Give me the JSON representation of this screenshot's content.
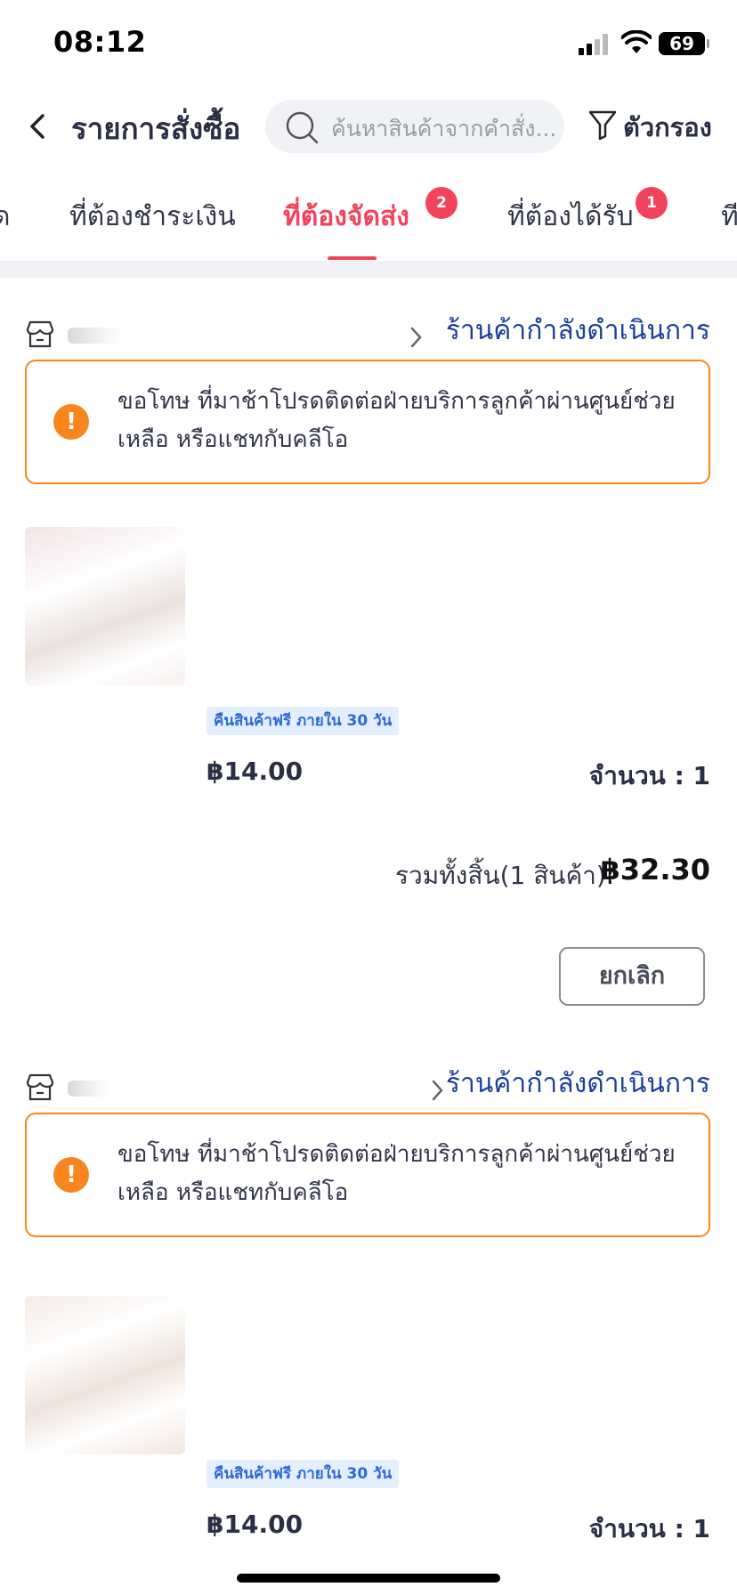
{
  "status_bar": {
    "time": "08:12",
    "battery": "69"
  },
  "header": {
    "title": "รายการสั่งซื้อ",
    "search_placeholder": "ค้นหาสินค้าจากคำสั่ง...",
    "filter_label": "ตัวกรอง"
  },
  "tabs": [
    {
      "label": "ด"
    },
    {
      "label": "ที่ต้องชำระเงิน"
    },
    {
      "label": "ที่ต้องจัดส่ง",
      "badge": "2",
      "active": true
    },
    {
      "label": "ที่ต้องได้รับ",
      "badge": "1"
    },
    {
      "label": "ที"
    }
  ],
  "orders": [
    {
      "shop_status": "ร้านค้ากำลังดำเนินการ",
      "notice": "ขอโทษ ที่มาช้าโปรดติดต่อฝ่ายบริการลูกค้าผ่านศูนย์ช่วยเหลือ หรือแชทกับคลีโอ",
      "tag": "คืนสินค้าฟรี ภายใน 30 วัน",
      "price": "฿14.00",
      "quantity": "จำนวน : 1",
      "total_label": "รวมทั้งสิ้น(1 สินค้า):",
      "total_value": "฿32.30",
      "cancel_label": "ยกเลิก"
    },
    {
      "shop_status": "ร้านค้ากำลังดำเนินการ",
      "notice": "ขอโทษ ที่มาช้าโปรดติดต่อฝ่ายบริการลูกค้าผ่านศูนย์ช่วยเหลือ หรือแชทกับคลีโอ",
      "tag": "คืนสินค้าฟรี ภายใน 30 วัน",
      "price": "฿14.00",
      "quantity": "จำนวน : 1"
    }
  ],
  "colors": {
    "accent": "#f2435b",
    "status_link": "#1b3f9c",
    "notice_border": "#f7861f",
    "tag_bg": "#e3efff"
  }
}
